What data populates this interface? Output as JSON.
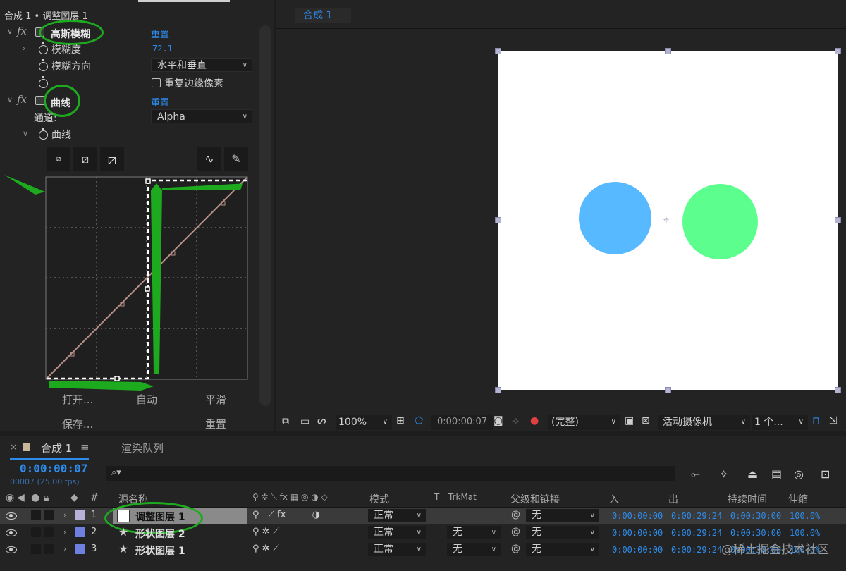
{
  "effects_panel": {
    "breadcrumb": "合成 1 • 调整图层 1",
    "gaussian": {
      "name": "高斯模糊",
      "reset": "重置",
      "blurriness_label": "模糊度",
      "blurriness_value": "72.1",
      "direction_label": "模糊方向",
      "direction_value": "水平和垂直",
      "repeat_edge_label": "重复边缘像素"
    },
    "curves": {
      "name": "曲线",
      "reset": "重置",
      "channel_label": "通道:",
      "channel_value": "Alpha",
      "curve_label": "曲线",
      "buttons": {
        "open": "打开...",
        "auto": "自动",
        "smooth": "平滑",
        "save": "保存...",
        "reset": "重置"
      }
    }
  },
  "viewer": {
    "tab": "合成 1",
    "zoom": "100%",
    "timecode": "0:00:00:07",
    "resolution": "(完整)",
    "camera": "活动摄像机",
    "views": "1 个...",
    "shapes": {
      "left_circle_color": "#57b9ff",
      "right_circle_color": "#5cff8e"
    }
  },
  "timeline": {
    "tab": "合成 1",
    "render_queue": "渲染队列",
    "current_time": "0:00:00:07",
    "frame_info": "00007 (25.00 fps)",
    "search_placeholder": "",
    "headers": {
      "hash": "#",
      "source_name": "源名称",
      "mode": "模式",
      "t": "T",
      "trkmat": "TrkMat",
      "parent": "父级和链接",
      "in": "入",
      "out": "出",
      "duration": "持续时间",
      "stretch": "伸缩"
    },
    "layers": [
      {
        "num": "1",
        "name": "调整图层 1",
        "color": "#b8b2d8",
        "mode": "正常",
        "trkmat": "",
        "parent": "无",
        "in": "0:00:00:00",
        "out": "0:00:29:24",
        "duration": "0:00:30:00",
        "stretch": "100.0%"
      },
      {
        "num": "2",
        "name": "形状图层 2",
        "color": "#6f7fe0",
        "mode": "正常",
        "trkmat": "无",
        "parent": "无",
        "in": "0:00:00:00",
        "out": "0:00:29:24",
        "duration": "0:00:30:00",
        "stretch": "100.0%"
      },
      {
        "num": "3",
        "name": "形状图层 1",
        "color": "#6f7fe0",
        "mode": "正常",
        "trkmat": "无",
        "parent": "无",
        "in": "0:00:00:00",
        "out": "0:00:29:24",
        "duration": "0:00:30:00",
        "stretch": "100.0%"
      }
    ]
  },
  "watermark": "@稀土掘金技术社区",
  "colors": {
    "accent": "#2d8ceb",
    "annotation_green": "#1eaa1e"
  }
}
